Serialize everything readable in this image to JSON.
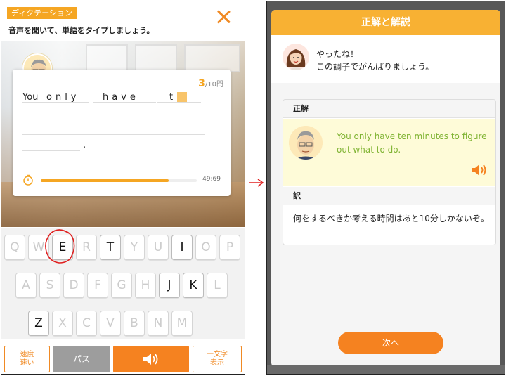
{
  "left": {
    "tag": "ディクテーション",
    "instruction": "音声を聞いて、単語をタイプしましょう。",
    "counter": {
      "current": "3",
      "total": "/10問"
    },
    "sentence": {
      "w0": "You",
      "w1": "only",
      "w2": "have",
      "w3": "t",
      "period": "."
    },
    "timer": {
      "value": "49:69",
      "progress": 0.82
    },
    "keyboard": {
      "row1": [
        {
          "k": "Q",
          "on": false
        },
        {
          "k": "W",
          "on": false
        },
        {
          "k": "E",
          "on": true
        },
        {
          "k": "R",
          "on": false
        },
        {
          "k": "T",
          "on": true
        },
        {
          "k": "Y",
          "on": false
        },
        {
          "k": "U",
          "on": false
        },
        {
          "k": "I",
          "on": true
        },
        {
          "k": "O",
          "on": false
        },
        {
          "k": "P",
          "on": false
        }
      ],
      "row2": [
        {
          "k": "A",
          "on": false
        },
        {
          "k": "S",
          "on": false
        },
        {
          "k": "D",
          "on": false
        },
        {
          "k": "F",
          "on": false
        },
        {
          "k": "G",
          "on": false
        },
        {
          "k": "H",
          "on": false
        },
        {
          "k": "J",
          "on": true
        },
        {
          "k": "K",
          "on": true
        },
        {
          "k": "L",
          "on": false
        }
      ],
      "row3": [
        {
          "k": "Z",
          "on": true
        },
        {
          "k": "X",
          "on": false
        },
        {
          "k": "C",
          "on": false
        },
        {
          "k": "V",
          "on": false
        },
        {
          "k": "B",
          "on": false
        },
        {
          "k": "N",
          "on": false
        },
        {
          "k": "M",
          "on": false
        }
      ]
    },
    "buttons": {
      "speed_l1": "速度",
      "speed_l2": "速い",
      "pass": "パス",
      "hint_l1": "一文字",
      "hint_l2": "表示"
    }
  },
  "right": {
    "title": "正解と解説",
    "praise_l1": "やったね！",
    "praise_l2": "この調子でがんばりましょう。",
    "correct_label": "正解",
    "answer_given": "You ",
    "answer_rest": "only have ten minutes to figure out what to do.",
    "translation_label": "訳",
    "translation": "何をするべきか考える時間はあと10分しかないぞ。",
    "next": "次へ"
  },
  "colors": {
    "accent": "#f5a623",
    "button": "#f58220",
    "answer": "#7fb332",
    "mark": "#e02020"
  }
}
